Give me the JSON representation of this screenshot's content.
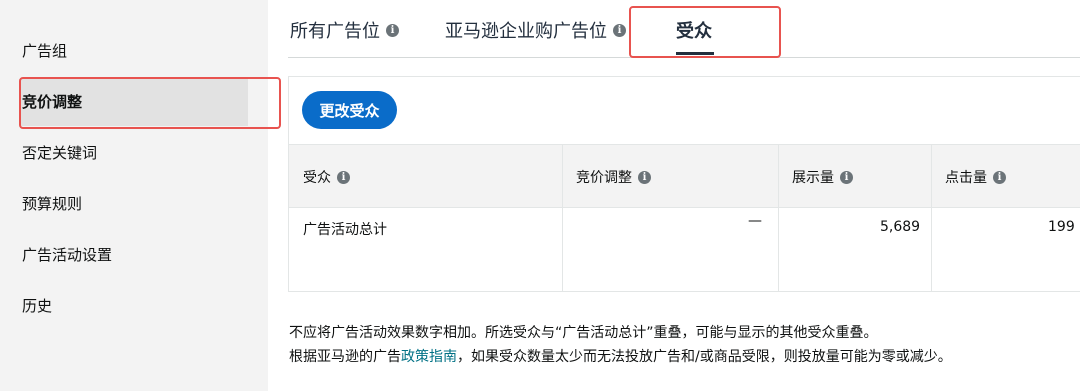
{
  "sidebar": {
    "items": [
      {
        "label": "广告组"
      },
      {
        "label": "竞价调整"
      },
      {
        "label": "否定关键词"
      },
      {
        "label": "预算规则"
      },
      {
        "label": "广告活动设置"
      },
      {
        "label": "历史"
      }
    ]
  },
  "tabs": [
    {
      "label": "所有广告位"
    },
    {
      "label": "亚马逊企业购广告位"
    },
    {
      "label": "受众"
    }
  ],
  "toolbar": {
    "change_audience_label": "更改受众"
  },
  "table": {
    "columns": [
      "受众",
      "竞价调整",
      "展示量",
      "点击量"
    ],
    "rows": [
      {
        "audience": "广告活动总计",
        "bid_adjustment": "—",
        "impressions": "5,689",
        "clicks": "199"
      }
    ]
  },
  "notes": {
    "line1": "不应将广告活动效果数字相加。所选受众与“广告活动总计”重叠，可能与显示的其他受众重叠。",
    "line2_prefix": "根据亚马逊的广告",
    "line2_link": "政策指南",
    "line2_suffix": "，如果受众数量太少而无法投放广告和/或商品受限，则投放量可能为零或减少。"
  },
  "colors": {
    "primary_button": "#0a6cc9",
    "highlight_box": "#e8534f",
    "link": "#007185"
  }
}
